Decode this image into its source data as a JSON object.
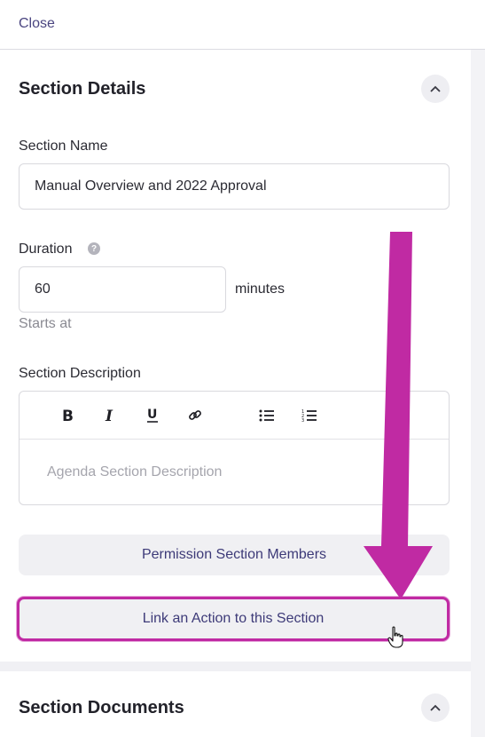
{
  "header": {
    "close_label": "Close"
  },
  "section_details": {
    "title": "Section Details",
    "name_label": "Section Name",
    "name_value": "Manual Overview and 2022 Approval",
    "duration_label": "Duration",
    "duration_value": "60",
    "duration_unit": "minutes",
    "starts_at_label": "Starts at",
    "description_label": "Section Description",
    "description_placeholder": "Agenda Section Description",
    "toolbar": [
      "bold-icon",
      "italic-icon",
      "underline-icon",
      "link-icon",
      "bullet-list-icon",
      "numbered-list-icon"
    ],
    "permission_button": "Permission Section Members",
    "link_action_button": "Link an Action to this Section"
  },
  "section_documents": {
    "title": "Section Documents"
  },
  "colors": {
    "accent": "#c02aa3",
    "link": "#4a4580",
    "button_text": "#3d3a78"
  }
}
